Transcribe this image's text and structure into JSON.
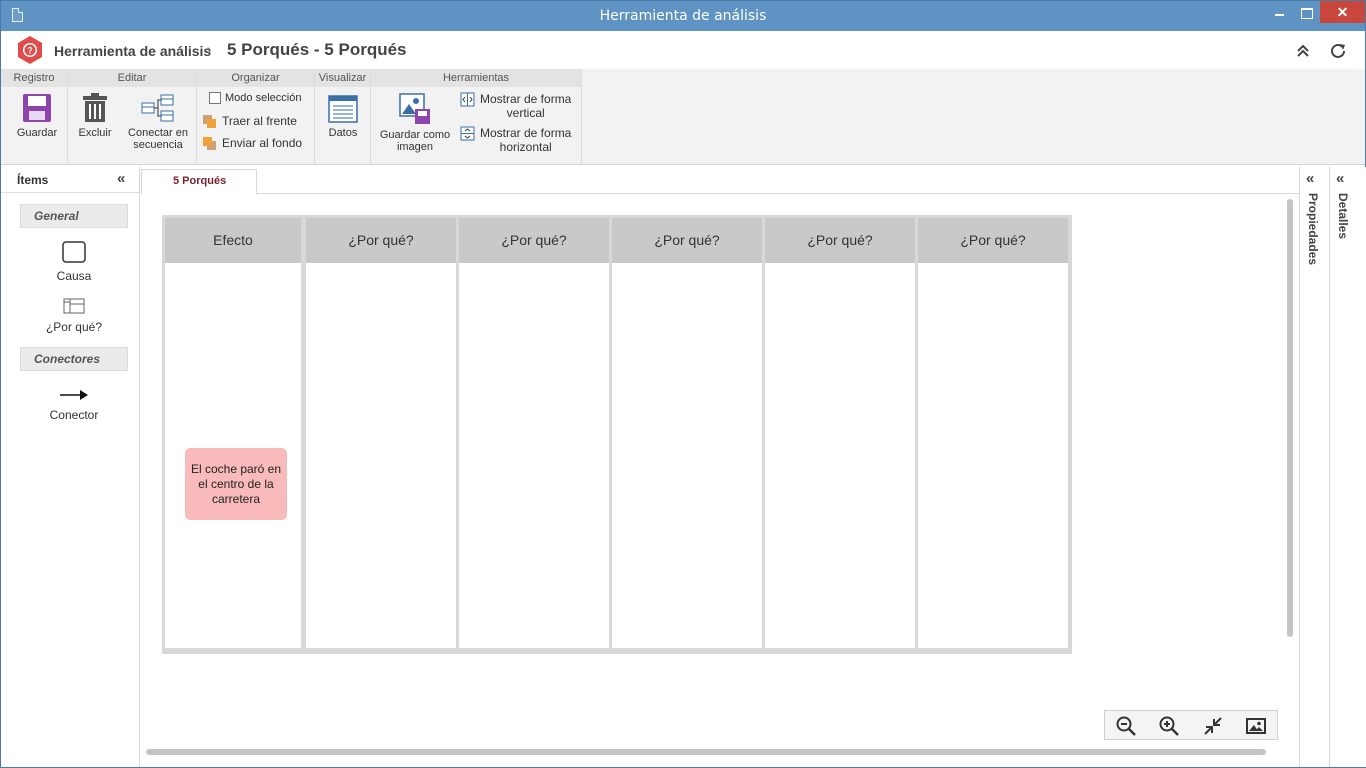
{
  "window": {
    "title": "Herramienta de análisis",
    "close_glyph": "✕"
  },
  "header": {
    "app_label": "Herramienta de análisis",
    "separator": "›",
    "page_title": "5 Porqués - 5 Porqués",
    "collapse_glyph": "⌃⌃",
    "refresh_glyph": "⟳"
  },
  "ribbon": {
    "groups": {
      "registro": "Registro",
      "editar": "Editar",
      "organizar": "Organizar",
      "visualizar": "Visualizar",
      "herramientas": "Herramientas"
    },
    "guardar": "Guardar",
    "excluir": "Excluir",
    "conectar_l1": "Conectar en",
    "conectar_l2": "secuencia",
    "modo_seleccion": "Modo selección",
    "traer_frente": "Traer al frente",
    "enviar_fondo": "Enviar al fondo",
    "datos": "Datos",
    "guardar_imagen_l1": "Guardar como",
    "guardar_imagen_l2": "imagen",
    "vertical_l1": "Mostrar de forma",
    "vertical_l2": "vertical",
    "horizontal_l1": "Mostrar de forma",
    "horizontal_l2": "horizontal"
  },
  "items_panel": {
    "title": "Ítems",
    "collapse_glyph": "«",
    "section_general": "General",
    "causa": "Causa",
    "por_que": "¿Por qué?",
    "section_conectores": "Conectores",
    "conector": "Conector"
  },
  "tabs": [
    {
      "label": "5 Porqués",
      "active": true
    }
  ],
  "board": {
    "columns": [
      "Efecto",
      "¿Por qué?",
      "¿Por qué?",
      "¿Por qué?",
      "¿Por qué?",
      "¿Por qué?"
    ],
    "note_text": "El coche paró en el centro de la carretera",
    "note_color": "#f8baba"
  },
  "right_panels": {
    "propiedades": "Propiedades",
    "detalles": "Detalles",
    "collapse_glyph": "«"
  },
  "colors": {
    "titlebar": "#5f93c4",
    "logo": "#e04b4b",
    "accent_text": "#7a1e2e"
  }
}
